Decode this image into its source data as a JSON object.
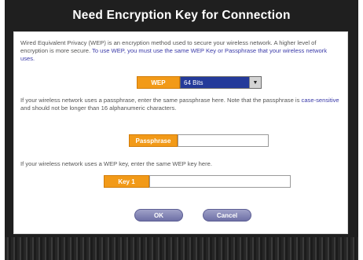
{
  "dialog": {
    "title": "Need Encryption Key for Connection",
    "intro_text_1": "Wired Equivalent Privacy (WEP) is an encryption method used to secure your wireless network. A higher level of encryption is more secure.",
    "intro_link": "To use WEP, you must use the same WEP Key or Passphrase that your wireless network uses.",
    "passphrase_text_1": "If your wireless network uses a passphrase, enter the same passphrase here. Note that the passphrase is",
    "passphrase_highlight": "case-sensitive",
    "passphrase_text_2": "and should not be longer than 16 alphanumeric characters.",
    "wepkey_text": "If your wireless network uses a WEP key, enter the same WEP key here."
  },
  "fields": {
    "wep_label": "WEP",
    "wep_value": "64 Bits",
    "passphrase_label": "Passphrase",
    "passphrase_value": "",
    "key_label": "Key 1",
    "key_value": ""
  },
  "buttons": {
    "ok": "OK",
    "cancel": "Cancel"
  },
  "icons": {
    "dropdown": "chevron-down-icon"
  },
  "colors": {
    "frame": "#1f1f1f",
    "label_orange": "#f29a18",
    "select_blue": "#243a9a",
    "button_purple": "#7e80b3"
  }
}
